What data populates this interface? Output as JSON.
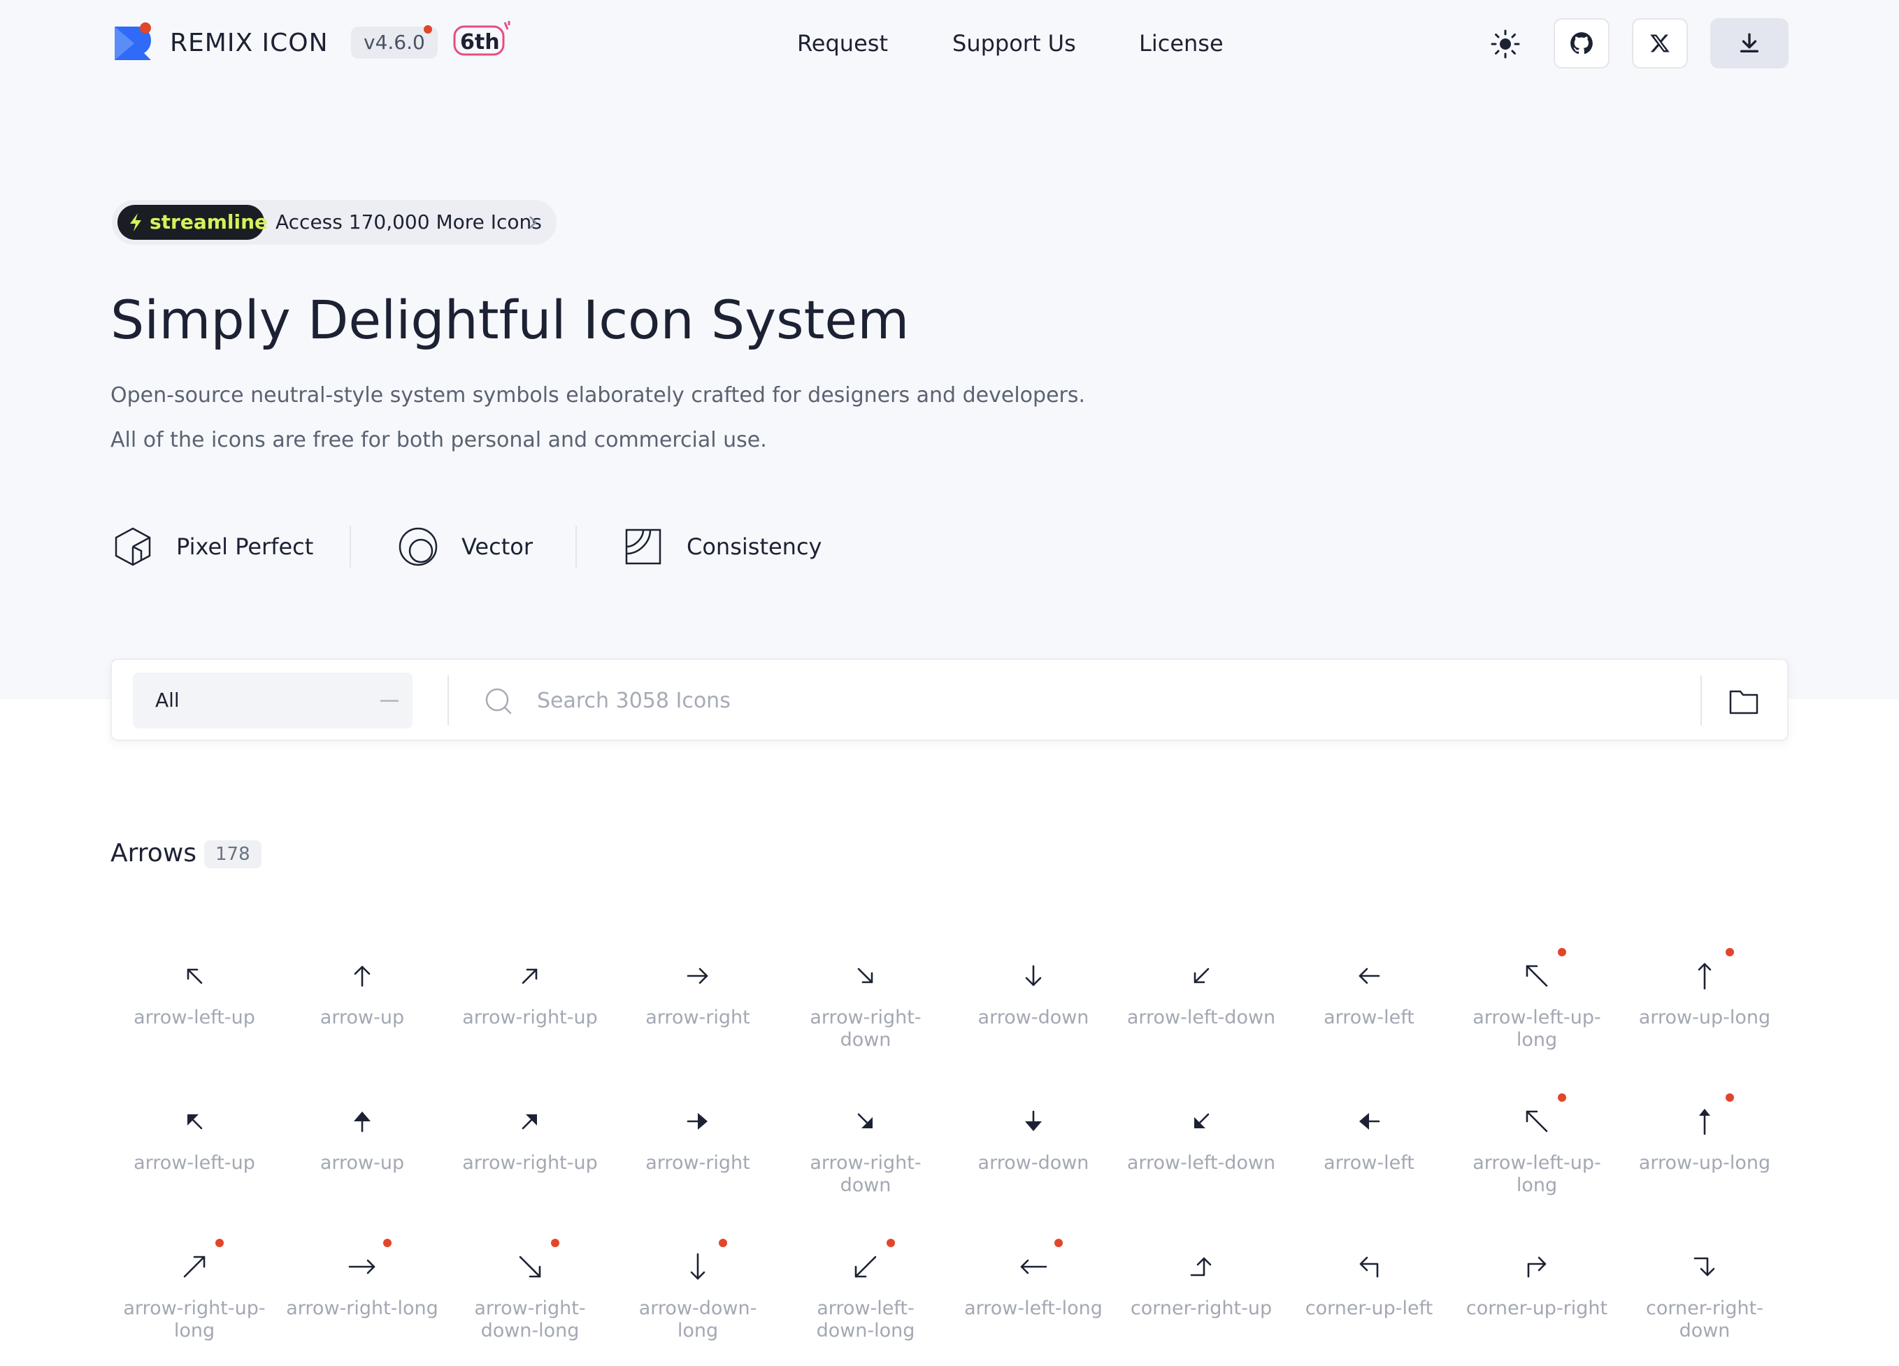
{
  "header": {
    "brand": "REMIX ICON",
    "version": "v4.6.0",
    "anniversary": "6th",
    "nav": [
      "Request",
      "Support Us",
      "License"
    ]
  },
  "promo": {
    "badge": "streamline",
    "text": "Access 170,000 More Icons"
  },
  "hero": {
    "title": "Simply Delightful Icon System",
    "subtitle_1": "Open-source neutral-style system symbols elaborately crafted for designers and developers.",
    "subtitle_2": "All of the icons are free for both personal and commercial use.",
    "features": [
      "Pixel Perfect",
      "Vector",
      "Consistency"
    ]
  },
  "search": {
    "category": "All",
    "placeholder": "Search 3058 Icons"
  },
  "section": {
    "title": "Arrows",
    "count": "178"
  },
  "colors": {
    "text": "#1c2233",
    "muted": "#a3a8b3",
    "accent": "#e2462a",
    "brand_blue": "#2f6bf6",
    "hero_bg": "#f7f8fb"
  },
  "icons": [
    {
      "name": "arrow-left-up",
      "icon": "arrow-left-up-icon",
      "is_new": false
    },
    {
      "name": "arrow-up",
      "icon": "arrow-up-icon",
      "is_new": false
    },
    {
      "name": "arrow-right-up",
      "icon": "arrow-right-up-icon",
      "is_new": false
    },
    {
      "name": "arrow-right",
      "icon": "arrow-right-icon",
      "is_new": false
    },
    {
      "name": "arrow-right-down",
      "icon": "arrow-right-down-icon",
      "is_new": false
    },
    {
      "name": "arrow-down",
      "icon": "arrow-down-icon",
      "is_new": false
    },
    {
      "name": "arrow-left-down",
      "icon": "arrow-left-down-icon",
      "is_new": false
    },
    {
      "name": "arrow-left",
      "icon": "arrow-left-icon",
      "is_new": false
    },
    {
      "name": "arrow-left-up-long",
      "icon": "arrow-left-up-long-icon",
      "is_new": true
    },
    {
      "name": "arrow-up-long",
      "icon": "arrow-up-long-icon",
      "is_new": true
    },
    {
      "name": "arrow-left-up",
      "icon": "arrow-left-up-fill-icon",
      "is_new": false
    },
    {
      "name": "arrow-up",
      "icon": "arrow-up-fill-icon",
      "is_new": false
    },
    {
      "name": "arrow-right-up",
      "icon": "arrow-right-up-fill-icon",
      "is_new": false
    },
    {
      "name": "arrow-right",
      "icon": "arrow-right-fill-icon",
      "is_new": false
    },
    {
      "name": "arrow-right-down",
      "icon": "arrow-right-down-fill-icon",
      "is_new": false
    },
    {
      "name": "arrow-down",
      "icon": "arrow-down-fill-icon",
      "is_new": false
    },
    {
      "name": "arrow-left-down",
      "icon": "arrow-left-down-fill-icon",
      "is_new": false
    },
    {
      "name": "arrow-left",
      "icon": "arrow-left-fill-icon",
      "is_new": false
    },
    {
      "name": "arrow-left-up-long",
      "icon": "arrow-left-up-long-fill-icon",
      "is_new": true
    },
    {
      "name": "arrow-up-long",
      "icon": "arrow-up-long-fill-icon",
      "is_new": true
    },
    {
      "name": "arrow-right-up-long",
      "icon": "arrow-right-up-long-icon",
      "is_new": true
    },
    {
      "name": "arrow-right-long",
      "icon": "arrow-right-long-icon",
      "is_new": true
    },
    {
      "name": "arrow-right-down-long",
      "icon": "arrow-right-down-long-icon",
      "is_new": true
    },
    {
      "name": "arrow-down-long",
      "icon": "arrow-down-long-icon",
      "is_new": true
    },
    {
      "name": "arrow-left-down-long",
      "icon": "arrow-left-down-long-icon",
      "is_new": true
    },
    {
      "name": "arrow-left-long",
      "icon": "arrow-left-long-icon",
      "is_new": true
    },
    {
      "name": "corner-right-up",
      "icon": "corner-right-up-icon",
      "is_new": false
    },
    {
      "name": "corner-up-left",
      "icon": "corner-up-left-icon",
      "is_new": false
    },
    {
      "name": "corner-up-right",
      "icon": "corner-up-right-icon",
      "is_new": false
    },
    {
      "name": "corner-right-down",
      "icon": "corner-right-down-icon",
      "is_new": false
    }
  ]
}
